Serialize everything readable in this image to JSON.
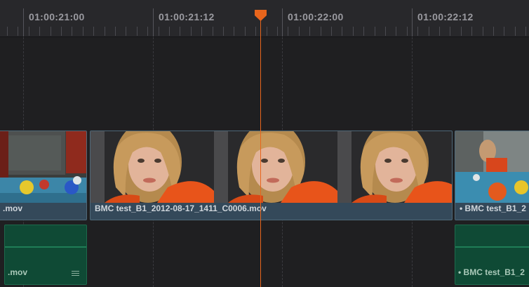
{
  "ruler": {
    "timecodes": [
      "01:00:21:00",
      "01:00:21:12",
      "01:00:22:00",
      "01:00:22:12"
    ]
  },
  "video_track": {
    "clips": [
      {
        "name": ".mov"
      },
      {
        "name": "BMC test_B1_2012-08-17_1411_C0006.mov"
      },
      {
        "name": "• BMC test_B1_2"
      }
    ]
  },
  "audio_track": {
    "clips": [
      {
        "name": ".mov",
        "icon": "menu-icon"
      },
      {
        "name": "• BMC test_B1_2"
      }
    ]
  },
  "colors": {
    "playhead": "#e8651c",
    "video_clip": "#34495a",
    "audio_clip": "#0f4a35"
  }
}
